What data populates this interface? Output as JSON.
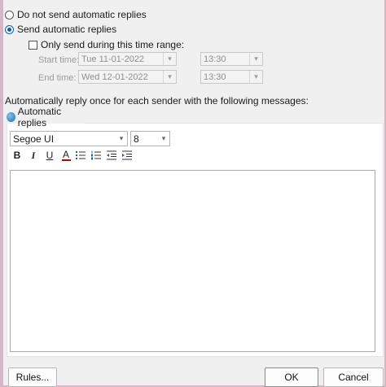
{
  "reply_mode": {
    "no_reply_label": "Do not send automatic replies",
    "send_label": "Send automatic replies",
    "selected": "send"
  },
  "time_range": {
    "checkbox_label": "Only send during this time range:",
    "checked": false,
    "start_label": "Start time:",
    "start_date": "Tue 11-01-2022",
    "start_time": "13:30",
    "end_label": "End time:",
    "end_date": "Wed 12-01-2022",
    "end_time": "13:30"
  },
  "instructions": "Automatically reply once for each sender with the following messages:",
  "tab": {
    "label": "Automatic replies",
    "icon": "globe-icon"
  },
  "editor": {
    "font_name": "Segoe UI",
    "font_size": "8",
    "toolbar": [
      "bold-icon",
      "italic-icon",
      "underline-icon",
      "font-color-icon",
      "bullets-icon",
      "numbering-icon",
      "decrease-indent-icon",
      "increase-indent-icon"
    ],
    "bold_glyph": "B",
    "italic_glyph": "I",
    "underline_glyph": "U",
    "font_color_glyph": "A",
    "font_color": "#c00000",
    "message": ""
  },
  "buttons": {
    "rules": "Rules...",
    "ok": "OK",
    "cancel": "Cancel"
  }
}
